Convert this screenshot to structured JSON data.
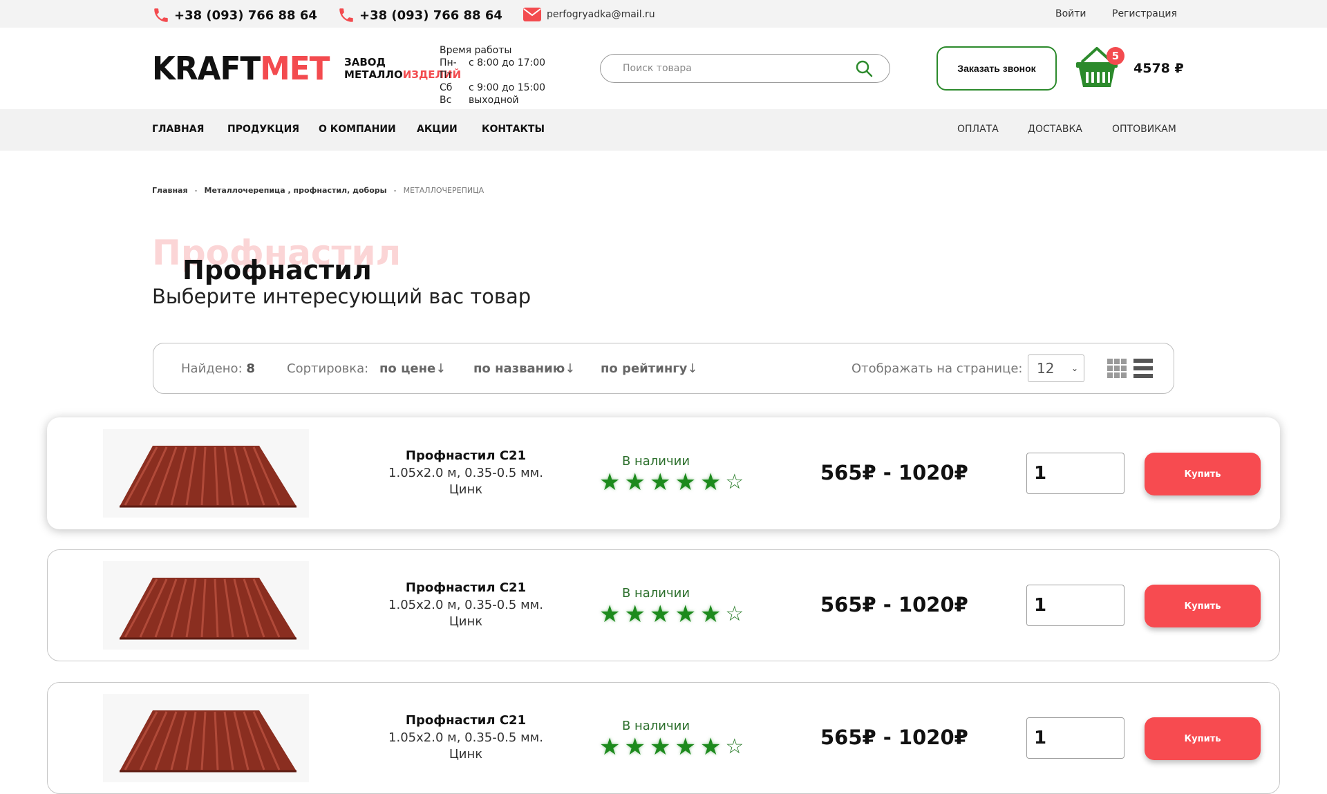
{
  "topbar": {
    "phone1": "+38 (093) 766 88 64",
    "phone2": "+38 (093) 766 88 64",
    "email": "perfogryadka@mail.ru",
    "login": "Войти",
    "register": "Регистрация"
  },
  "header": {
    "logo_left": "KRAFT",
    "logo_right": "MET",
    "logo_sub1": "ЗАВОД",
    "logo_sub2a": "МЕТАЛЛО",
    "logo_sub2b": "ИЗДЕЛИЙ",
    "hours_title": "Время работы",
    "hours": [
      {
        "d": "Пн-Пт",
        "t": "с 8:00 до 17:00"
      },
      {
        "d": "Сб",
        "t": "с 9:00 до 15:00"
      },
      {
        "d": "Вс",
        "t": "выходной"
      }
    ],
    "search_placeholder": "Поиск товара",
    "callback": "Заказать звонок",
    "cart_count": "5",
    "cart_total": "4578 ₽"
  },
  "nav": {
    "left": [
      "ГЛАВНАЯ",
      "ПРОДУКЦИЯ",
      "О КОМПАНИИ",
      "АКЦИИ",
      "КОНТАКТЫ"
    ],
    "right": [
      "ОПЛАТА",
      "ДОСТАВКА",
      "ОПТОВИКАМ"
    ]
  },
  "breadcrumbs": {
    "home": "Главная",
    "sep": "-",
    "category": "Металлочерепица , профнастил, доборы",
    "current": "МЕТАЛЛОЧЕРЕПИЦА"
  },
  "page": {
    "ghost_title": "Профнастил",
    "title": "Профнастил",
    "subtitle": "Выберите интересующий вас товар"
  },
  "filter": {
    "found_label": "Найдено:",
    "found_count": "8",
    "sort_label": "Сортировка:",
    "sort_price": "по цене",
    "sort_name": "по названию",
    "sort_rating": "по рейтингу",
    "per_page_label": "Отображать на странице:",
    "per_page": "12"
  },
  "products": [
    {
      "title": "Профнастил С21",
      "size": "1.05x2.0 м, 0.35-0.5 мм.",
      "coating": "Цинк",
      "stock": "В наличии",
      "rating": 5,
      "price": "565₽ - 1020₽",
      "qty": "1",
      "buy": "Купить"
    },
    {
      "title": "Профнастил С21",
      "size": "1.05x2.0 м, 0.35-0.5 мм.",
      "coating": "Цинк",
      "stock": "В наличии",
      "rating": 5,
      "price": "565₽ - 1020₽",
      "qty": "1",
      "buy": "Купить"
    },
    {
      "title": "Профнастил С21",
      "size": "1.05x2.0 м, 0.35-0.5 мм.",
      "coating": "Цинк",
      "stock": "В наличии",
      "rating": 5,
      "price": "565₽ - 1020₽",
      "qty": "1",
      "buy": "Купить"
    }
  ],
  "colors": {
    "accent_red": "#f74b50",
    "accent_green": "#2c8a2c"
  }
}
